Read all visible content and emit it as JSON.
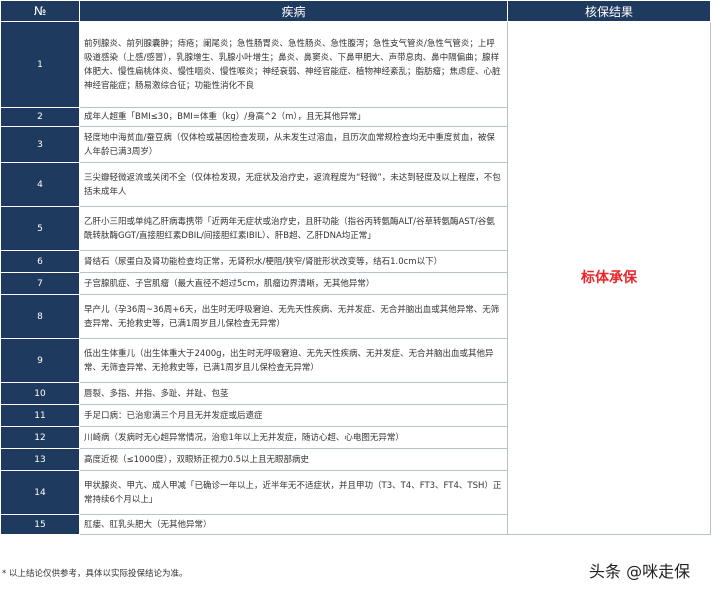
{
  "headers": {
    "no": "№",
    "disease": "疾病",
    "result": "核保结果"
  },
  "rows": [
    {
      "no": "1",
      "text": "前列腺炎、前列腺囊肿；痔疮；阑尾炎；急性肠胃炎、急性肠炎、急性腹泻；急性支气管炎/急性气管炎；上呼吸道感染（上感/感冒），乳腺增生、乳腺小叶增生；鼻炎、鼻窦炎、下鼻甲肥大、声带息肉、鼻中隔偏曲；腺样体肥大、慢性扁桃体炎、慢性咽炎、慢性喉炎；神经衰弱、神经官能症、植物神经紊乱；脂肪瘤；焦虑症、心脏神经官能症；肠易激综合征；功能性消化不良"
    },
    {
      "no": "2",
      "text": "成年人超重「BMI≤30，BMI=体重（kg）/身高^2（m），且无其他异常」"
    },
    {
      "no": "3",
      "text": "轻度地中海贫血/蚕豆病（仅体检或基因检查发现，从未发生过溶血，且历次血常规检查均无中重度贫血，被保人年龄已满3周岁）"
    },
    {
      "no": "4",
      "text": "三尖瓣轻微返流或关闭不全（仅体检发现，无症状及治疗史，返流程度为“轻微”，未达到轻度及以上程度，不包括未成年人"
    },
    {
      "no": "5",
      "text": "乙肝小三阳或单纯乙肝病毒携带「近两年无症状或治疗史，且肝功能（指谷丙转氨酶ALT/谷草转氨酶AST/谷氨酰转肽酶GGT/直接胆红素DBIL/间接胆红素IBIL）、肝B超、乙肝DNA均正常」"
    },
    {
      "no": "6",
      "text": "肾结石（尿蛋白及肾功能检查均正常，无肾积水/梗阻/狭窄/肾脏形状改变等，结石1.0cm以下）"
    },
    {
      "no": "7",
      "text": "子宫腺肌症、子宫肌瘤（最大直径不超过5cm，肌瘤边界清晰，无其他异常）"
    },
    {
      "no": "8",
      "text": "早产儿（孕36周~36周+6天，出生时无呼吸窘迫、无先天性疾病、无并发症、无合并脑出血或其他异常、无筛查异常、无抢救史等，已满1周岁且儿保检查无异常）"
    },
    {
      "no": "9",
      "text": "低出生体重儿（出生体重大于2400g，出生时无呼吸窘迫、无先天性疾病、无并发症、无合并脑出血或其他异常、无筛查异常、无抢救史等，已满1周岁且儿保检查无异常）"
    },
    {
      "no": "10",
      "text": "唇裂、多指、并指、多趾、并趾、包茎"
    },
    {
      "no": "11",
      "text": "手足口病：已治愈满三个月且无并发症或后遗症"
    },
    {
      "no": "12",
      "text": "川崎病（发病时无心超异常情况，治愈1年以上无并发症，随访心超、心电图无异常）"
    },
    {
      "no": "13",
      "text": "高度近视（≤1000度），双眼矫正视力0.5以上且无眼部病史"
    },
    {
      "no": "14",
      "text": "甲状腺炎、甲亢、成人甲减「已确诊一年以上，近半年无不适症状，并且甲功（T3、T4、FT3、FT4、TSH）正常持续6个月以上」"
    },
    {
      "no": "15",
      "text": "肛瘘、肛乳头肥大（无其他异常）"
    }
  ],
  "result_text": "标体承保",
  "footnote": "* 以上结论仅供参考，具体以实际投保结论为准。",
  "watermark": "头条 @咪走保",
  "colors": {
    "header_bg": "#1f3a5f",
    "result": "#e8262b"
  }
}
